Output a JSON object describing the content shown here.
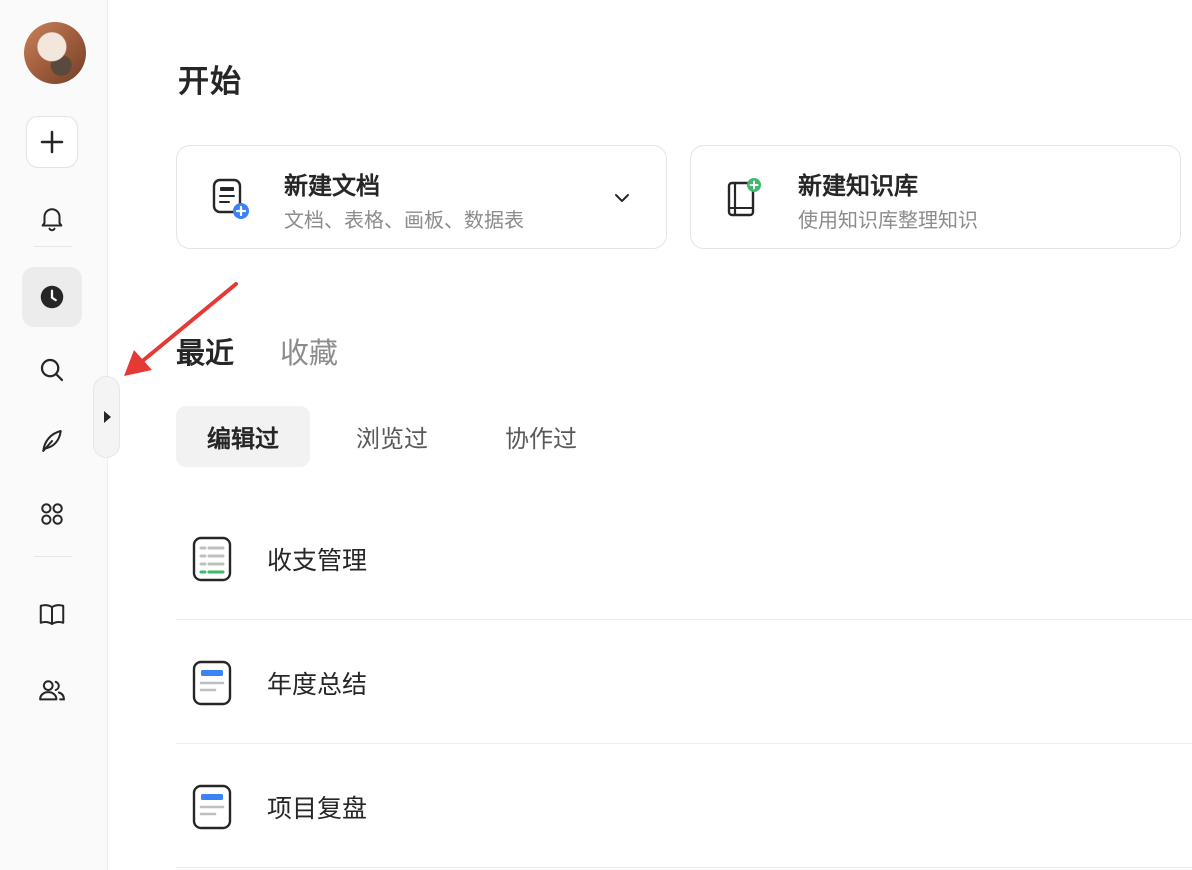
{
  "sidebar": {
    "items": [
      {
        "name": "avatar"
      },
      {
        "name": "add",
        "icon": "plus-icon"
      },
      {
        "name": "notifications",
        "icon": "bell-icon"
      },
      {
        "name": "recent",
        "icon": "clock-icon",
        "active": true
      },
      {
        "name": "search",
        "icon": "search-icon"
      },
      {
        "name": "explore",
        "icon": "feather-icon"
      },
      {
        "name": "apps",
        "icon": "apps-icon"
      },
      {
        "name": "knowledge",
        "icon": "book-icon"
      },
      {
        "name": "team",
        "icon": "users-icon"
      }
    ],
    "collapse_icon": "caret-right-icon"
  },
  "main": {
    "title": "开始",
    "cards": {
      "doc": {
        "title": "新建文档",
        "subtitle": "文档、表格、画板、数据表",
        "icon": "new-doc-icon"
      },
      "kb": {
        "title": "新建知识库",
        "subtitle": "使用知识库整理知识",
        "icon": "new-knowledge-base-icon"
      }
    },
    "tabs": [
      {
        "label": "最近",
        "active": true
      },
      {
        "label": "收藏",
        "active": false
      }
    ],
    "subtabs": [
      {
        "label": "编辑过",
        "active": true
      },
      {
        "label": "浏览过",
        "active": false
      },
      {
        "label": "协作过",
        "active": false
      }
    ],
    "list": [
      {
        "label": "收支管理",
        "icon": "sheet-icon"
      },
      {
        "label": "年度总结",
        "icon": "doc-icon"
      },
      {
        "label": "项目复盘",
        "icon": "doc-icon"
      }
    ]
  },
  "colors": {
    "accent_blue": "#3b82f6",
    "accent_green": "#3fb96b",
    "arrow_red": "#e53935"
  }
}
